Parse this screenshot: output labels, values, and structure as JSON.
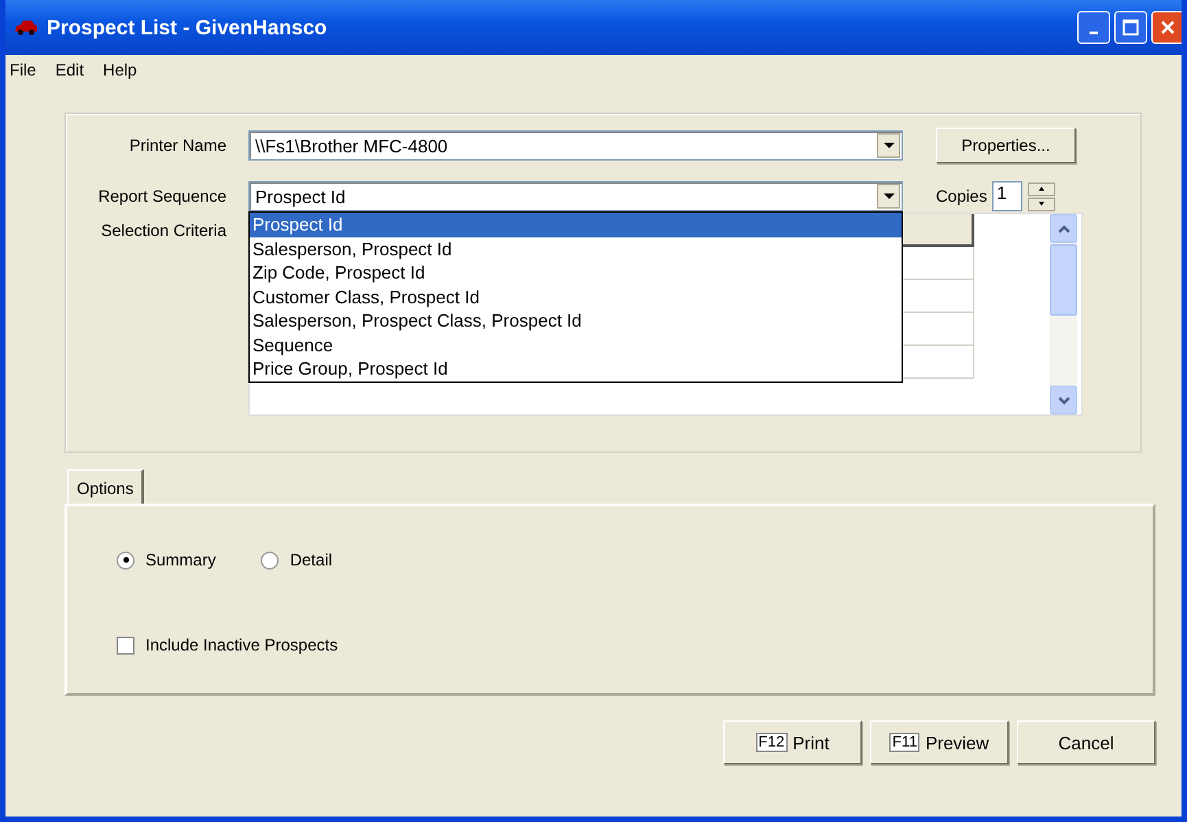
{
  "window": {
    "title": "Prospect List - GivenHansco"
  },
  "menu": [
    "File",
    "Edit",
    "Help"
  ],
  "printer": {
    "label": "Printer Name",
    "value": "\\\\Fs1\\Brother MFC-4800",
    "button": "Properties..."
  },
  "report_sequence": {
    "label": "Report Sequence",
    "value": "Prospect Id",
    "expanded": true,
    "options": [
      {
        "label": "Prospect Id",
        "selected": true
      },
      {
        "label": "Salesperson, Prospect Id",
        "selected": false
      },
      {
        "label": "Zip Code, Prospect Id",
        "selected": false
      },
      {
        "label": "Customer Class, Prospect Id",
        "selected": false
      },
      {
        "label": "Salesperson, Prospect Class, Prospect Id",
        "selected": false
      },
      {
        "label": "Sequence",
        "selected": false
      },
      {
        "label": "Price Group, Prospect Id",
        "selected": false
      }
    ]
  },
  "copies": {
    "label": "Copies",
    "value": "1"
  },
  "selection_criteria": {
    "label": "Selection Criteria"
  },
  "tabs": [
    {
      "label": "Options",
      "selected": true
    }
  ],
  "options": [
    {
      "kind": "radio",
      "label": "Summary",
      "checked": true
    },
    {
      "kind": "radio",
      "label": "Detail",
      "checked": false
    },
    {
      "kind": "checkbox",
      "label": "Include Inactive Prospects",
      "checked": false
    }
  ],
  "buttons": [
    {
      "key": "F12",
      "label": "Print"
    },
    {
      "key": "F11",
      "label": "Preview"
    },
    {
      "label": "Cancel"
    }
  ]
}
